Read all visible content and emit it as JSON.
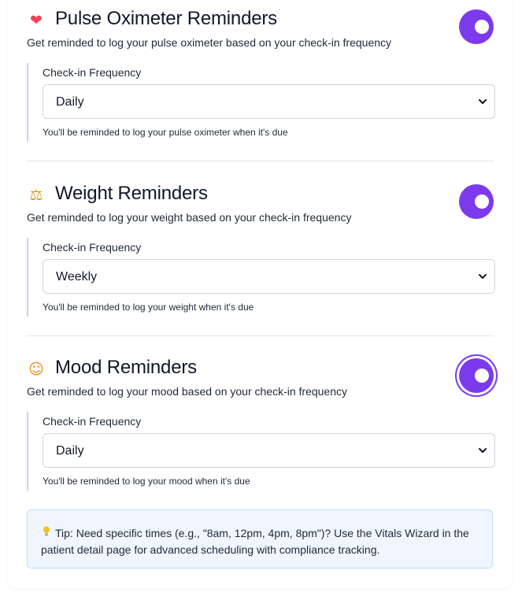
{
  "sections": [
    {
      "emoji": "❤",
      "emoji_color": "#f43f5e",
      "icon": "heart-icon",
      "title": "Pulse Oximeter Reminders",
      "description": "Get reminded to log your pulse oximeter based on your check-in frequency",
      "enabled": true,
      "freq_label": "Check-in Frequency",
      "frequency": "Daily",
      "help": "You'll be reminded to log your pulse oximeter when it's due"
    },
    {
      "emoji": "⚖",
      "emoji_color": "#d4a017",
      "icon": "balance-scale-icon",
      "title": "Weight Reminders",
      "description": "Get reminded to log your weight based on your check-in frequency",
      "enabled": true,
      "freq_label": "Check-in Frequency",
      "frequency": "Weekly",
      "help": "You'll be reminded to log your weight when it's due"
    },
    {
      "emoji": "☺",
      "emoji_color": "#e98a15",
      "icon": "smiling-face-icon",
      "title": "Mood Reminders",
      "description": "Get reminded to log your mood based on your check-in frequency",
      "enabled": true,
      "freq_label": "Check-in Frequency",
      "frequency": "Daily",
      "help": "You'll be reminded to log your mood when it's due"
    }
  ],
  "tip": {
    "icon": "lightbulb-icon",
    "text": "Tip: Need specific times (e.g., \"8am, 12pm, 4pm, 8pm\")? Use the Vitals Wizard in the patient detail page for advanced scheduling with compliance tracking."
  },
  "colors": {
    "accent": "#7c3aed",
    "tip_background": "#eff6ff",
    "tip_border": "#bfdbfe"
  }
}
